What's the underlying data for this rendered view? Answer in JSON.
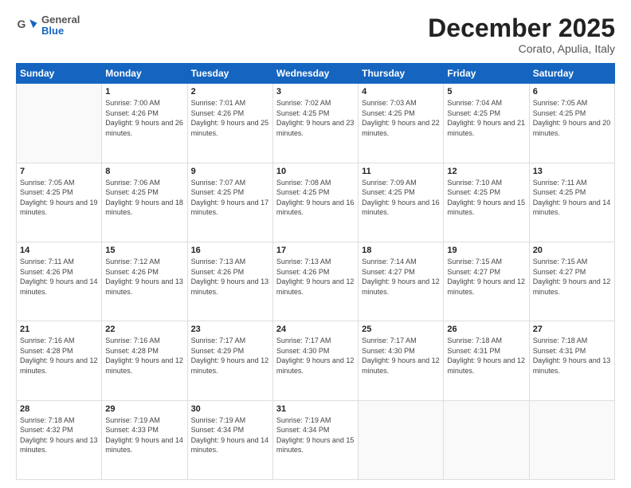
{
  "header": {
    "logo_line1": "General",
    "logo_line2": "Blue",
    "title": "December 2025",
    "subtitle": "Corato, Apulia, Italy"
  },
  "weekdays": [
    "Sunday",
    "Monday",
    "Tuesday",
    "Wednesday",
    "Thursday",
    "Friday",
    "Saturday"
  ],
  "weeks": [
    [
      {
        "day": "",
        "sunrise": "",
        "sunset": "",
        "daylight": ""
      },
      {
        "day": "1",
        "sunrise": "7:00 AM",
        "sunset": "4:26 PM",
        "daylight": "9 hours and 26 minutes."
      },
      {
        "day": "2",
        "sunrise": "7:01 AM",
        "sunset": "4:26 PM",
        "daylight": "9 hours and 25 minutes."
      },
      {
        "day": "3",
        "sunrise": "7:02 AM",
        "sunset": "4:25 PM",
        "daylight": "9 hours and 23 minutes."
      },
      {
        "day": "4",
        "sunrise": "7:03 AM",
        "sunset": "4:25 PM",
        "daylight": "9 hours and 22 minutes."
      },
      {
        "day": "5",
        "sunrise": "7:04 AM",
        "sunset": "4:25 PM",
        "daylight": "9 hours and 21 minutes."
      },
      {
        "day": "6",
        "sunrise": "7:05 AM",
        "sunset": "4:25 PM",
        "daylight": "9 hours and 20 minutes."
      }
    ],
    [
      {
        "day": "7",
        "sunrise": "7:05 AM",
        "sunset": "4:25 PM",
        "daylight": "9 hours and 19 minutes."
      },
      {
        "day": "8",
        "sunrise": "7:06 AM",
        "sunset": "4:25 PM",
        "daylight": "9 hours and 18 minutes."
      },
      {
        "day": "9",
        "sunrise": "7:07 AM",
        "sunset": "4:25 PM",
        "daylight": "9 hours and 17 minutes."
      },
      {
        "day": "10",
        "sunrise": "7:08 AM",
        "sunset": "4:25 PM",
        "daylight": "9 hours and 16 minutes."
      },
      {
        "day": "11",
        "sunrise": "7:09 AM",
        "sunset": "4:25 PM",
        "daylight": "9 hours and 16 minutes."
      },
      {
        "day": "12",
        "sunrise": "7:10 AM",
        "sunset": "4:25 PM",
        "daylight": "9 hours and 15 minutes."
      },
      {
        "day": "13",
        "sunrise": "7:11 AM",
        "sunset": "4:25 PM",
        "daylight": "9 hours and 14 minutes."
      }
    ],
    [
      {
        "day": "14",
        "sunrise": "7:11 AM",
        "sunset": "4:26 PM",
        "daylight": "9 hours and 14 minutes."
      },
      {
        "day": "15",
        "sunrise": "7:12 AM",
        "sunset": "4:26 PM",
        "daylight": "9 hours and 13 minutes."
      },
      {
        "day": "16",
        "sunrise": "7:13 AM",
        "sunset": "4:26 PM",
        "daylight": "9 hours and 13 minutes."
      },
      {
        "day": "17",
        "sunrise": "7:13 AM",
        "sunset": "4:26 PM",
        "daylight": "9 hours and 12 minutes."
      },
      {
        "day": "18",
        "sunrise": "7:14 AM",
        "sunset": "4:27 PM",
        "daylight": "9 hours and 12 minutes."
      },
      {
        "day": "19",
        "sunrise": "7:15 AM",
        "sunset": "4:27 PM",
        "daylight": "9 hours and 12 minutes."
      },
      {
        "day": "20",
        "sunrise": "7:15 AM",
        "sunset": "4:27 PM",
        "daylight": "9 hours and 12 minutes."
      }
    ],
    [
      {
        "day": "21",
        "sunrise": "7:16 AM",
        "sunset": "4:28 PM",
        "daylight": "9 hours and 12 minutes."
      },
      {
        "day": "22",
        "sunrise": "7:16 AM",
        "sunset": "4:28 PM",
        "daylight": "9 hours and 12 minutes."
      },
      {
        "day": "23",
        "sunrise": "7:17 AM",
        "sunset": "4:29 PM",
        "daylight": "9 hours and 12 minutes."
      },
      {
        "day": "24",
        "sunrise": "7:17 AM",
        "sunset": "4:30 PM",
        "daylight": "9 hours and 12 minutes."
      },
      {
        "day": "25",
        "sunrise": "7:17 AM",
        "sunset": "4:30 PM",
        "daylight": "9 hours and 12 minutes."
      },
      {
        "day": "26",
        "sunrise": "7:18 AM",
        "sunset": "4:31 PM",
        "daylight": "9 hours and 12 minutes."
      },
      {
        "day": "27",
        "sunrise": "7:18 AM",
        "sunset": "4:31 PM",
        "daylight": "9 hours and 13 minutes."
      }
    ],
    [
      {
        "day": "28",
        "sunrise": "7:18 AM",
        "sunset": "4:32 PM",
        "daylight": "9 hours and 13 minutes."
      },
      {
        "day": "29",
        "sunrise": "7:19 AM",
        "sunset": "4:33 PM",
        "daylight": "9 hours and 14 minutes."
      },
      {
        "day": "30",
        "sunrise": "7:19 AM",
        "sunset": "4:34 PM",
        "daylight": "9 hours and 14 minutes."
      },
      {
        "day": "31",
        "sunrise": "7:19 AM",
        "sunset": "4:34 PM",
        "daylight": "9 hours and 15 minutes."
      },
      {
        "day": "",
        "sunrise": "",
        "sunset": "",
        "daylight": ""
      },
      {
        "day": "",
        "sunrise": "",
        "sunset": "",
        "daylight": ""
      },
      {
        "day": "",
        "sunrise": "",
        "sunset": "",
        "daylight": ""
      }
    ]
  ]
}
